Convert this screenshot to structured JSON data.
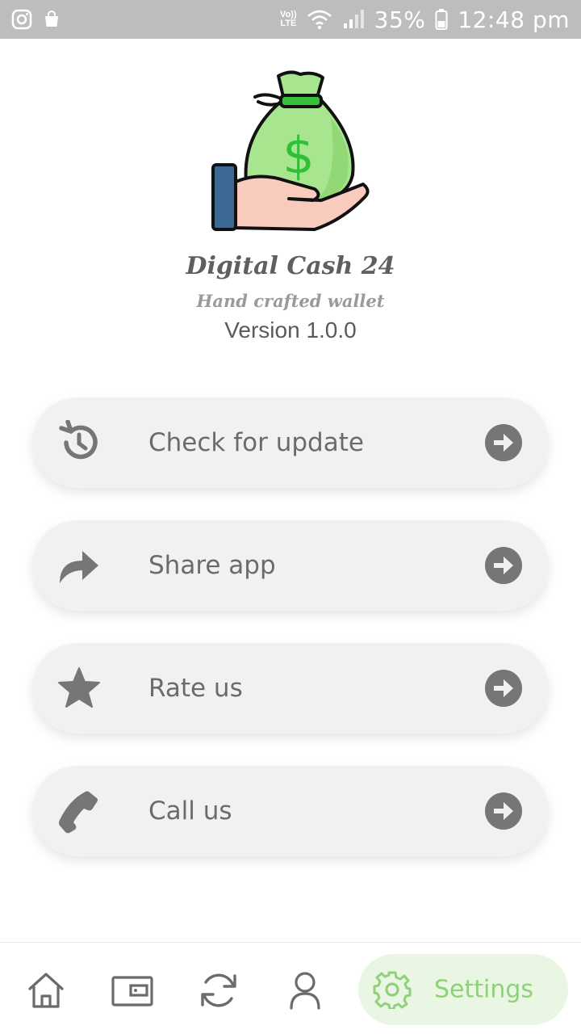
{
  "status_bar": {
    "volte": "Vo))",
    "lte": "LTE",
    "battery": "35%",
    "time": "12:48 pm"
  },
  "header": {
    "title": "Digital Cash 24",
    "subtitle": "Hand crafted wallet",
    "version": "Version 1.0.0"
  },
  "menu": {
    "items": [
      {
        "label": "Check for update",
        "icon": "history-icon"
      },
      {
        "label": "Share app",
        "icon": "share-icon"
      },
      {
        "label": "Rate us",
        "icon": "star-icon"
      },
      {
        "label": "Call us",
        "icon": "phone-icon"
      }
    ]
  },
  "bottom_nav": {
    "items": [
      {
        "icon": "home-icon"
      },
      {
        "icon": "wallet-icon"
      },
      {
        "icon": "sync-icon"
      },
      {
        "icon": "profile-icon"
      }
    ],
    "active": {
      "icon": "gear-icon",
      "label": "Settings"
    }
  },
  "colors": {
    "status_bar_bg": "#bdbdbd",
    "card_bg": "#f1f1f1",
    "icon_gray": "#767676",
    "accent_green": "#8fd17a",
    "active_tab_bg": "#e9f6e3"
  }
}
